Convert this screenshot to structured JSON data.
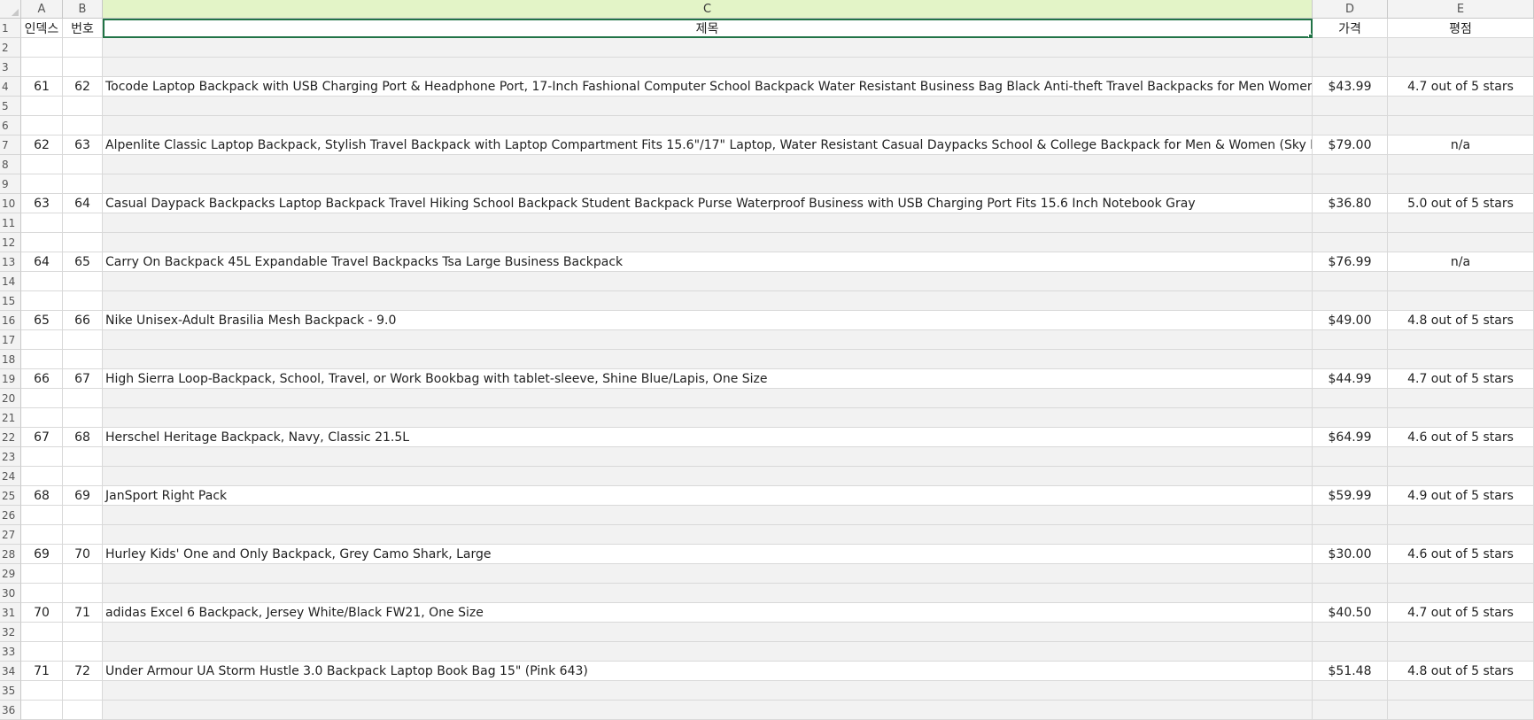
{
  "columns": [
    "A",
    "B",
    "C",
    "D",
    "E"
  ],
  "header_row": {
    "a": "인덱스",
    "b": "번호",
    "c": "제목",
    "d": "가격",
    "e": "평점"
  },
  "row_numbers": [
    "1",
    "2",
    "3",
    "4",
    "5",
    "6",
    "7",
    "8",
    "9",
    "10",
    "11",
    "12",
    "13",
    "14",
    "15",
    "16",
    "17",
    "18",
    "19",
    "20",
    "21",
    "22",
    "23",
    "24",
    "25",
    "26",
    "27",
    "28",
    "29",
    "30",
    "31",
    "32",
    "33",
    "34",
    "35",
    "36"
  ],
  "products": [
    {
      "index": "61",
      "number": "62",
      "title": "Tocode Laptop Backpack with USB Charging Port & Headphone Port, 17-Inch Fashional Computer School Backpack Water Resistant Business Bag Black Anti-theft Travel Backpacks for Men Women",
      "price": "$43.99",
      "rating": "4.7 out of 5 stars"
    },
    {
      "index": "62",
      "number": "63",
      "title": "Alpenlite Classic Laptop Backpack, Stylish Travel Backpack with Laptop Compartment Fits 15.6\"/17\" Laptop, Water Resistant Casual Daypacks School & College Backpack for Men & Women (Sky Blue",
      "price": "$79.00",
      "rating": "n/a"
    },
    {
      "index": "63",
      "number": "64",
      "title": "Casual Daypack Backpacks Laptop Backpack Travel Hiking School Backpack Student Backpack Purse Waterproof Business with USB Charging Port Fits 15.6 Inch Notebook Gray",
      "price": "$36.80",
      "rating": "5.0 out of 5 stars"
    },
    {
      "index": "64",
      "number": "65",
      "title": "Carry On Backpack 45L Expandable Travel Backpacks Tsa Large Business Backpack",
      "price": "$76.99",
      "rating": "n/a"
    },
    {
      "index": "65",
      "number": "66",
      "title": "Nike Unisex-Adult Brasilia Mesh Backpack - 9.0",
      "price": "$49.00",
      "rating": "4.8 out of 5 stars"
    },
    {
      "index": "66",
      "number": "67",
      "title": "High Sierra Loop-Backpack, School, Travel, or Work Bookbag with tablet-sleeve, Shine Blue/Lapis, One Size",
      "price": "$44.99",
      "rating": "4.7 out of 5 stars"
    },
    {
      "index": "67",
      "number": "68",
      "title": "Herschel Heritage Backpack, Navy, Classic 21.5L",
      "price": "$64.99",
      "rating": "4.6 out of 5 stars"
    },
    {
      "index": "68",
      "number": "69",
      "title": "JanSport Right Pack",
      "price": "$59.99",
      "rating": "4.9 out of 5 stars"
    },
    {
      "index": "69",
      "number": "70",
      "title": "Hurley Kids' One and Only Backpack, Grey Camo Shark, Large",
      "price": "$30.00",
      "rating": "4.6 out of 5 stars"
    },
    {
      "index": "70",
      "number": "71",
      "title": "adidas Excel 6 Backpack, Jersey White/Black FW21, One Size",
      "price": "$40.50",
      "rating": "4.7 out of 5 stars"
    },
    {
      "index": "71",
      "number": "72",
      "title": "Under Armour UA Storm Hustle 3.0 Backpack Laptop Book Bag 15\" (Pink 643)",
      "price": "$51.48",
      "rating": "4.8 out of 5 stars"
    }
  ]
}
